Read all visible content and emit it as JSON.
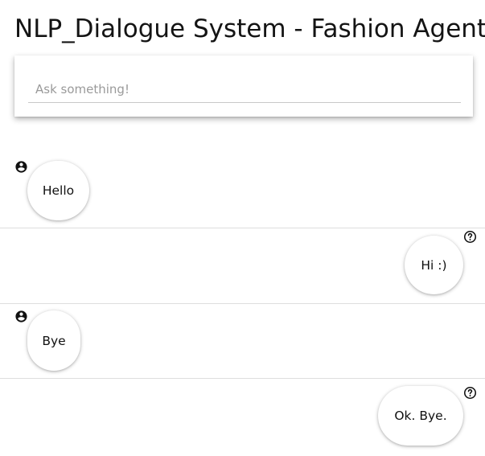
{
  "header": {
    "title": "NLP_Dialogue System - Fashion Agent"
  },
  "search": {
    "placeholder": "Ask something!",
    "value": ""
  },
  "messages": [
    {
      "sender": "user",
      "text": "Hello",
      "icon": "user-icon"
    },
    {
      "sender": "agent",
      "text": "Hi :)",
      "icon": "help-icon"
    },
    {
      "sender": "user",
      "text": "Bye",
      "icon": "user-icon"
    },
    {
      "sender": "agent",
      "text": "Ok. Bye.",
      "icon": "help-icon"
    }
  ]
}
